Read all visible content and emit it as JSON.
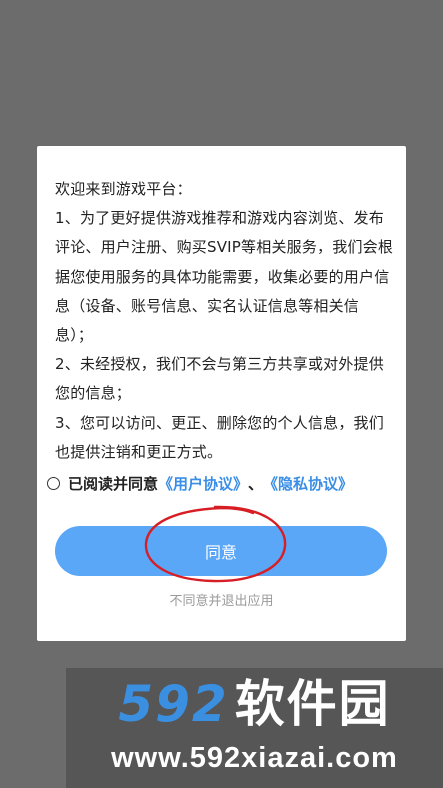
{
  "dialog": {
    "paragraphs": [
      "欢迎来到游戏平台：",
      "1、为了更好提供游戏推荐和游戏内容浏览、发布评论、用户注册、购买SVIP等相关服务，我们会根据您使用服务的具体功能需要，收集必要的用户信息（设备、账号信息、实名认证信息等相关信息）；",
      "2、未经授权，我们不会与第三方共享或对外提供您的信息；",
      "3、您可以访问、更正、删除您的个人信息，我们也提供注销和更正方式。"
    ],
    "agree_prefix": "已阅读并同意",
    "user_agreement": "《用户协议》",
    "separator": "、",
    "privacy_agreement": "《隐私协议》",
    "agree_button": "同意",
    "disagree_link": "不同意并退出应用"
  },
  "watermark": {
    "number": "592",
    "name": "软件园",
    "url": "www.592xiazai.com"
  },
  "colors": {
    "backdrop": "#6c6c6c",
    "button": "#5aa6f7",
    "link": "#3a8ee6",
    "annotation_circle": "#d81e25"
  }
}
